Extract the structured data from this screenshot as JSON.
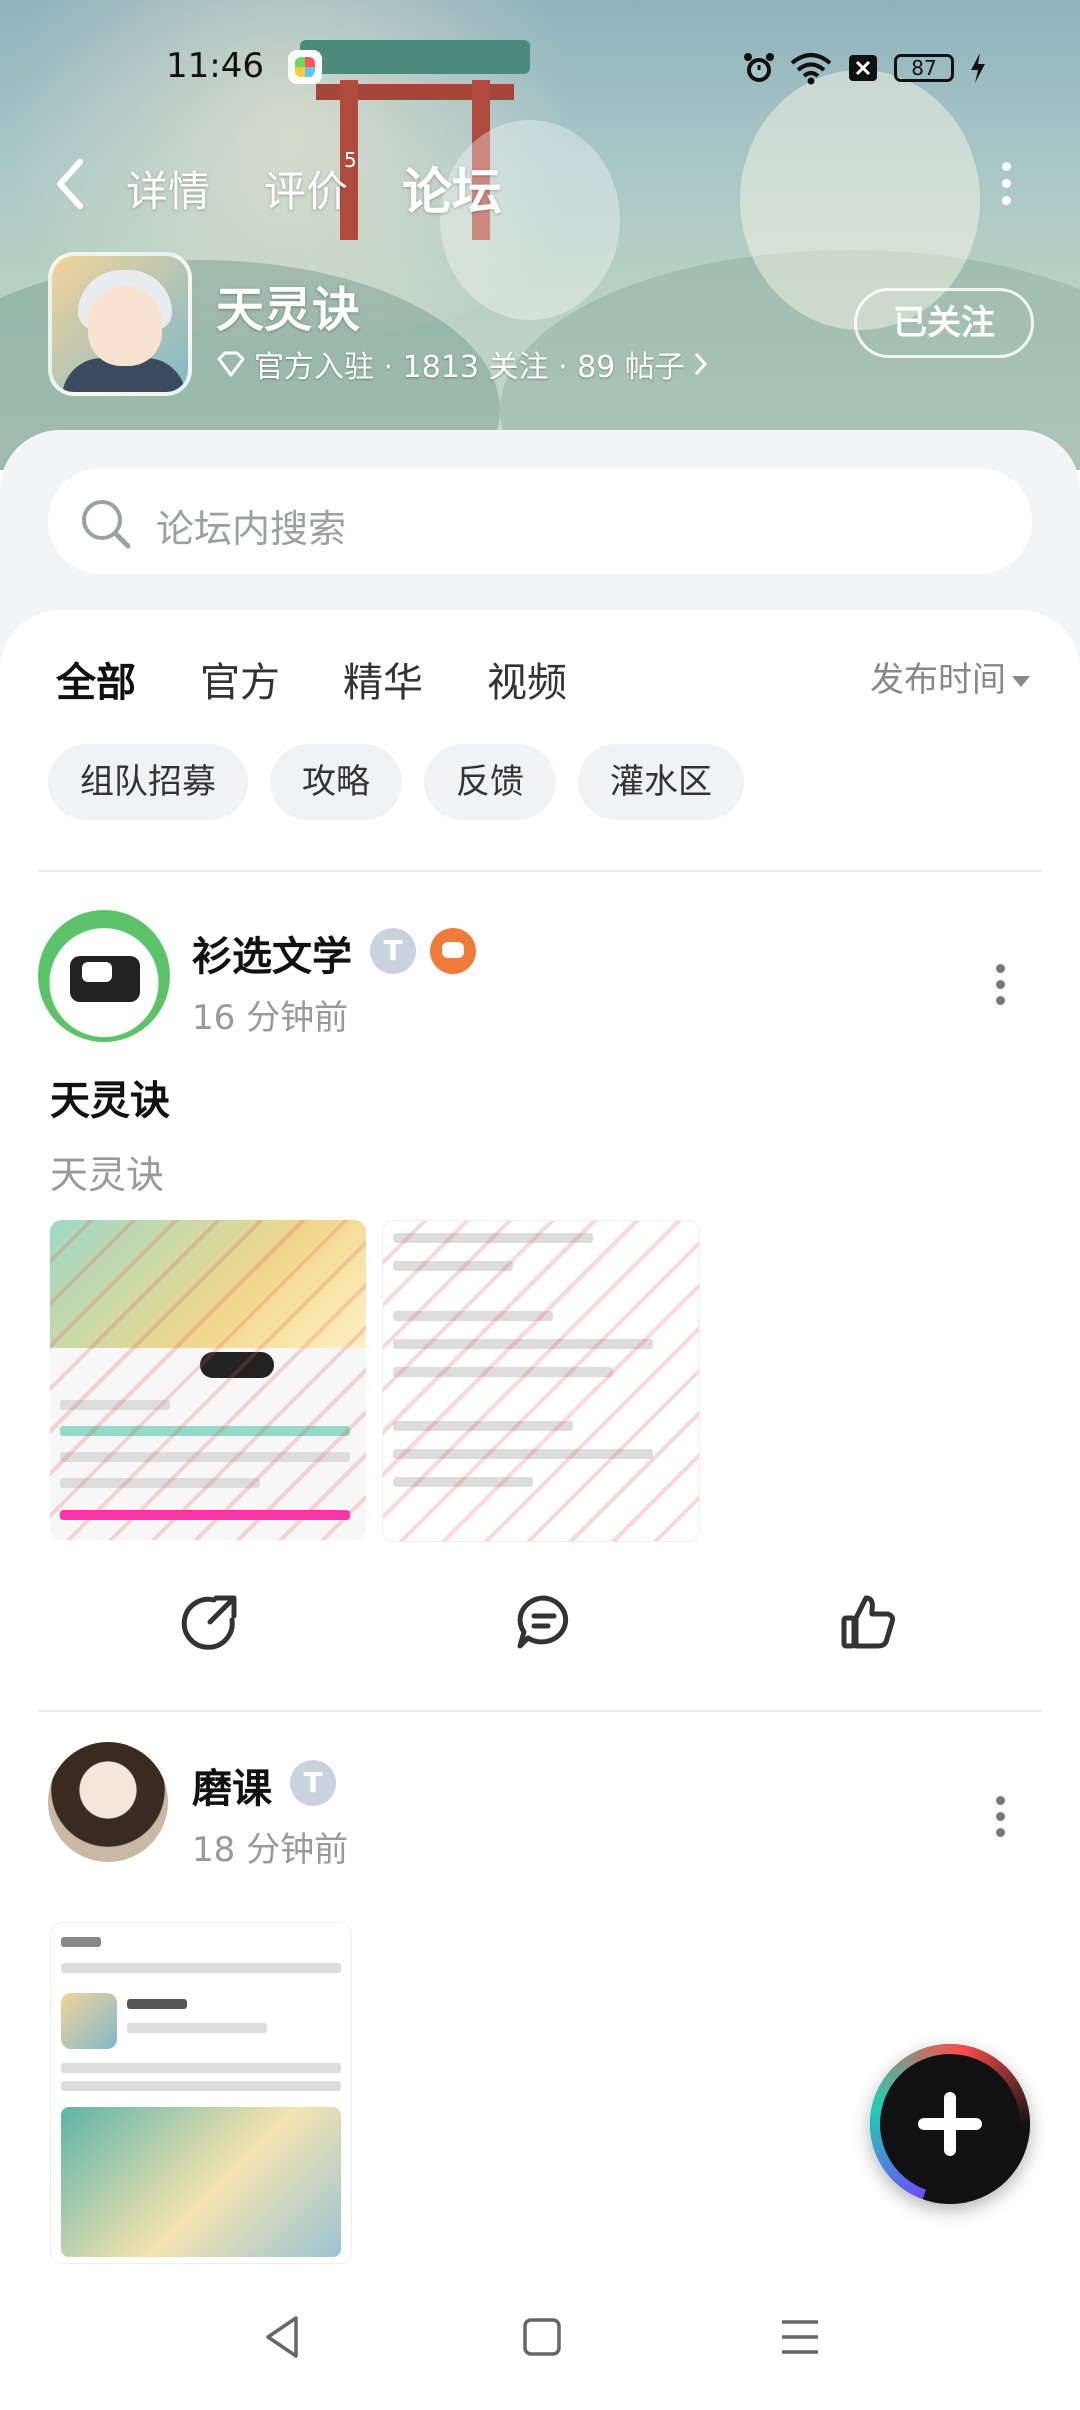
{
  "status_bar": {
    "time": "11:46",
    "battery": "87"
  },
  "header": {
    "tabs": [
      {
        "label": "详情"
      },
      {
        "label": "评价",
        "badge": "5"
      },
      {
        "label": "论坛",
        "active": true
      }
    ]
  },
  "game": {
    "name": "天灵诀",
    "meta": "官方入驻 · 1813 关注 · 89 帖子",
    "follow_label": "已关注"
  },
  "search": {
    "placeholder": "论坛内搜索"
  },
  "filter_tabs": [
    "全部",
    "官方",
    "精华",
    "视频"
  ],
  "sort_label": "发布时间",
  "chips": [
    "组队招募",
    "攻略",
    "反馈",
    "灌水区"
  ],
  "posts": [
    {
      "author": "衫选文学",
      "time": "16 分钟前",
      "title": "天灵诀",
      "body": "天灵诀"
    },
    {
      "author": "磨课",
      "time": "18 分钟前"
    }
  ],
  "colors": {
    "accent": "#20d0b0",
    "text_secondary": "#999999"
  },
  "icons": [
    "back-icon",
    "more-icon",
    "search-icon",
    "share-icon",
    "comment-icon",
    "like-icon",
    "plus-icon",
    "nav-back-icon",
    "nav-home-icon",
    "nav-menu-icon"
  ]
}
